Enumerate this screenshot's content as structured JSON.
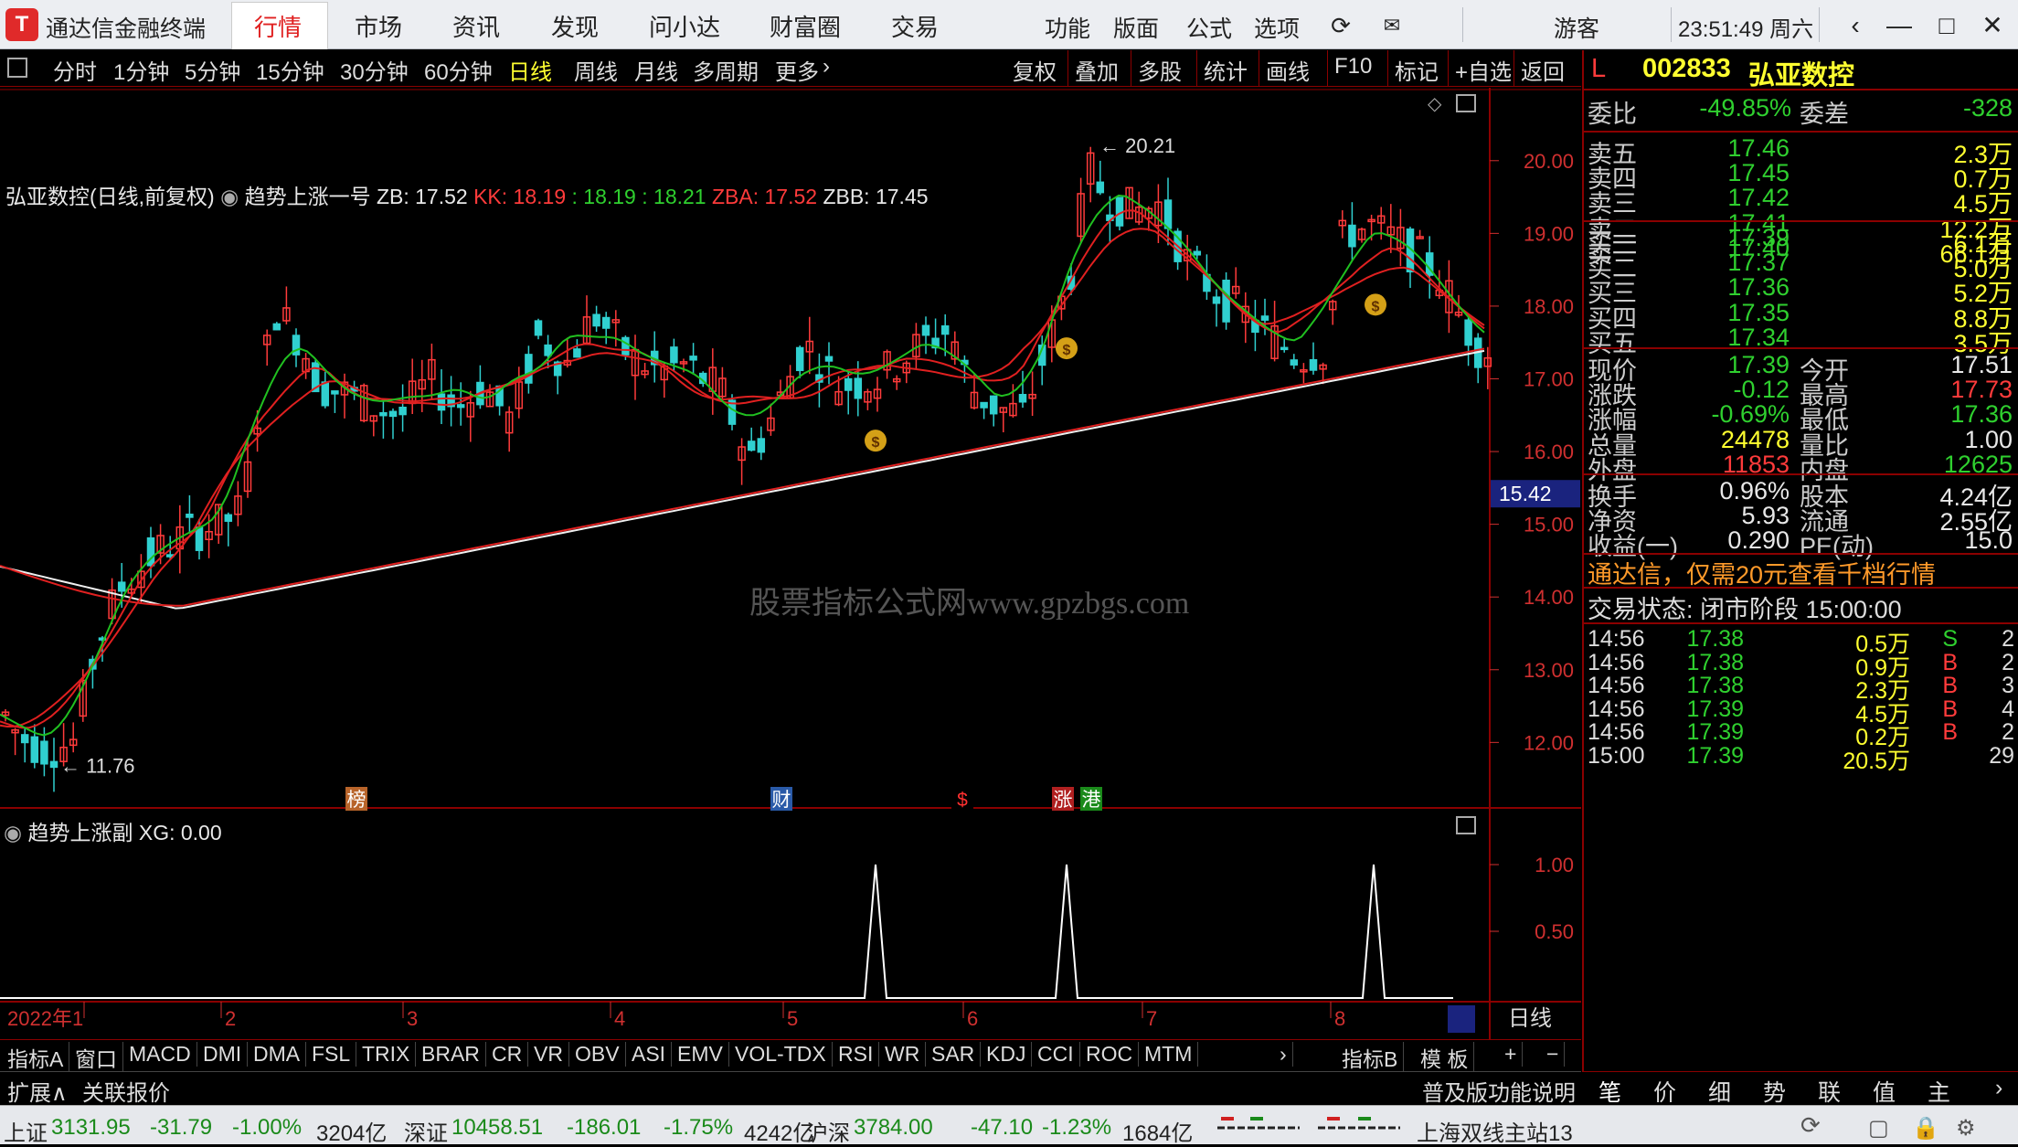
{
  "app": {
    "title": "通达信金融终端",
    "logo": "T"
  },
  "menu": [
    "行情",
    "市场",
    "资讯",
    "发现",
    "问小达",
    "财富圈",
    "交易"
  ],
  "menu_active": "行情",
  "topright": [
    "功能",
    "版面",
    "公式",
    "选项"
  ],
  "guest": "游客",
  "clock": "23:51:49 周六",
  "periods": [
    "分时",
    "1分钟",
    "5分钟",
    "15分钟",
    "30分钟",
    "60分钟",
    "日线",
    "周线",
    "月线",
    "多周期",
    "更多"
  ],
  "period_active": "日线",
  "tools": [
    "复权",
    "叠加",
    "多股",
    "统计",
    "画线",
    "F10",
    "标记",
    "+自选",
    "返回"
  ],
  "chart_info": {
    "stock": "弘亚数控(日线,前复权)",
    "indicator": "趋势上涨一号",
    "zb": "ZB: 17.52",
    "kk": "KK: 18.19",
    "kk2": ": 18.19",
    "kk3": ": 18.21",
    "zba": "ZBA: 17.52",
    "zbb": "ZBB: 17.45"
  },
  "watermark": "股票指标公式网www.gpzbgs.com",
  "chart_data": {
    "type": "candlestick",
    "ylim": [
      11.2,
      20.5
    ],
    "y_ticks": [
      "20.00",
      "19.00",
      "18.00",
      "17.00",
      "16.00",
      "15.00",
      "14.00",
      "13.00",
      "12.00"
    ],
    "cursor_price": "15.42",
    "high_label": "20.21",
    "low_label": "11.76",
    "x_labels": [
      "2022年1",
      "2",
      "3",
      "4",
      "5",
      "6",
      "7",
      "8"
    ],
    "period_label": "日线",
    "event_markers": [
      "榜",
      "财",
      "$",
      "涨",
      "港"
    ],
    "sub_indicator": {
      "name": "趋势上涨副",
      "value": "XG: 0.00",
      "ylim": [
        0,
        1.2
      ],
      "ticks": [
        "1.00",
        "0.50"
      ],
      "spikes_at": [
        0.54,
        0.62,
        0.86
      ]
    }
  },
  "quote": {
    "prefix": "L",
    "code": "002833",
    "name": "弘亚数控",
    "weibi_label": "委比",
    "weibi": "-49.85%",
    "weicha_label": "委差",
    "weicha": "-328",
    "asks": [
      {
        "label": "卖五",
        "price": "17.46",
        "vol": "2.3万"
      },
      {
        "label": "卖四",
        "price": "17.45",
        "vol": "0.7万"
      },
      {
        "label": "卖三",
        "price": "17.42",
        "vol": "4.5万"
      },
      {
        "label": "卖二",
        "price": "17.41",
        "vol": "12.2万"
      },
      {
        "label": "卖一",
        "price": "17.40",
        "vol": "66.1万"
      }
    ],
    "bids": [
      {
        "label": "买一",
        "price": "17.39",
        "vol": "6.1万"
      },
      {
        "label": "买二",
        "price": "17.37",
        "vol": "5.0万"
      },
      {
        "label": "买三",
        "price": "17.36",
        "vol": "5.2万"
      },
      {
        "label": "买四",
        "price": "17.35",
        "vol": "8.8万"
      },
      {
        "label": "买五",
        "price": "17.34",
        "vol": "3.5万"
      }
    ],
    "stats": [
      {
        "k1": "现价",
        "v1": "17.39",
        "c1": "g",
        "k2": "今开",
        "v2": "17.51",
        "c2": "w"
      },
      {
        "k1": "涨跌",
        "v1": "-0.12",
        "c1": "g",
        "k2": "最高",
        "v2": "17.73",
        "c2": "r"
      },
      {
        "k1": "涨幅",
        "v1": "-0.69%",
        "c1": "g",
        "k2": "最低",
        "v2": "17.36",
        "c2": "g"
      },
      {
        "k1": "总量",
        "v1": "24478",
        "c1": "y",
        "k2": "量比",
        "v2": "1.00",
        "c2": "w"
      },
      {
        "k1": "外盘",
        "v1": "11853",
        "c1": "r",
        "k2": "内盘",
        "v2": "12625",
        "c2": "g"
      }
    ],
    "stats2": [
      {
        "k1": "换手",
        "v1": "0.96%",
        "k2": "股本",
        "v2": "4.24亿"
      },
      {
        "k1": "净资",
        "v1": "5.93",
        "k2": "流通",
        "v2": "2.55亿"
      },
      {
        "k1": "收益(一)",
        "v1": "0.290",
        "k2": "PE(动)",
        "v2": "15.0"
      }
    ],
    "promo": "通达信，仅需20元查看千档行情",
    "trade_status": "交易状态: 闭市阶段 15:00:00",
    "ticks": [
      {
        "t": "14:56",
        "p": "17.38",
        "v": "0.5万",
        "bs": "S",
        "n": "2"
      },
      {
        "t": "14:56",
        "p": "17.38",
        "v": "0.9万",
        "bs": "B",
        "n": "2"
      },
      {
        "t": "14:56",
        "p": "17.38",
        "v": "2.3万",
        "bs": "B",
        "n": "3"
      },
      {
        "t": "14:56",
        "p": "17.39",
        "v": "4.5万",
        "bs": "B",
        "n": "4"
      },
      {
        "t": "14:56",
        "p": "17.39",
        "v": "0.2万",
        "bs": "B",
        "n": "2"
      },
      {
        "t": "15:00",
        "p": "17.39",
        "v": "20.5万",
        "bs": "",
        "n": "29"
      }
    ],
    "bottom_tabs": [
      "笔",
      "价",
      "细",
      "势",
      "联",
      "值",
      "主"
    ]
  },
  "indicator_tabs": [
    "指标A",
    "窗口",
    "MACD",
    "DMI",
    "DMA",
    "FSL",
    "TRIX",
    "BRAR",
    "CR",
    "VR",
    "OBV",
    "ASI",
    "EMV",
    "VOL-TDX",
    "RSI",
    "WR",
    "SAR",
    "KDJ",
    "CCI",
    "ROC",
    "MTM"
  ],
  "indicator_tabs_right": [
    "指标B",
    "模 板"
  ],
  "ext": {
    "expand": "扩展∧",
    "related": "关联报价",
    "help": "普及版功能说明"
  },
  "status": {
    "sh_label": "上证",
    "sh_val": "3131.95",
    "sh_chg": "-31.79",
    "sh_pct": "-1.00%",
    "sh_amt": "3204亿",
    "sz_label": "深证",
    "sz_val": "10458.51",
    "sz_chg": "-186.01",
    "sz_pct": "-1.75%",
    "sz_amt": "4242亿",
    "hs_label": "沪深",
    "hs_val": "3784.00",
    "hs_chg": "-47.10",
    "hs_pct": "-1.23%",
    "hs_amt": "1684亿",
    "server": "上海双线主站13"
  },
  "colors": {
    "up": "#ff3b3b",
    "down": "#30d0d0",
    "bg": "#000000",
    "grid": "#8b0000"
  }
}
